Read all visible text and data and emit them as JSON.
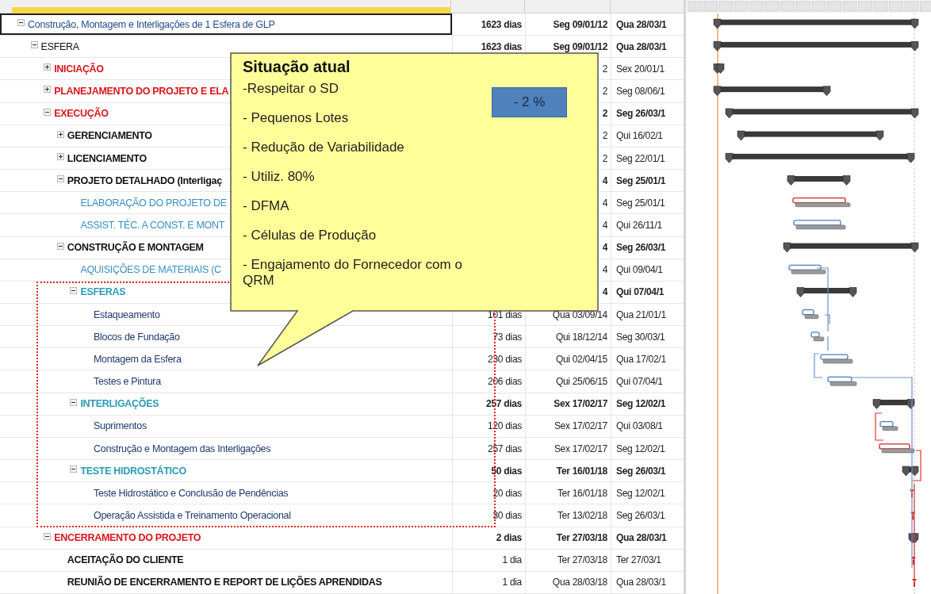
{
  "tasks": [
    {
      "name": "Construção, Montagem e Interligações de 1 Esfera de GLP",
      "color": "#1f4e8c",
      "bold": false,
      "selected": true,
      "expanded": true,
      "duration": "1623 dias",
      "start": "Seg 09/01/12",
      "finish": "Qua 28/03/1",
      "children": [
        {
          "name": "ESFERA",
          "color": "#111111",
          "bold": false,
          "selected": false,
          "expanded": true,
          "duration": "1623 dias",
          "start": "Seg 09/01/12",
          "finish": "Qua 28/03/1",
          "children": [
            {
              "name": "INICIAÇÃO",
              "color": "#d9141c",
              "bold": true,
              "selected": false,
              "expanded": false,
              "start": "2",
              "finish": "Sex 20/01/1"
            },
            {
              "name": "PLANEJAMENTO DO PROJETO E ELA",
              "color": "#d9141c",
              "bold": true,
              "selected": false,
              "expanded": false,
              "start": "2",
              "finish": "Seg 08/06/1"
            },
            {
              "name": "EXECUÇÃO",
              "color": "#d9141c",
              "bold": true,
              "selected": false,
              "expanded": true,
              "start": "2",
              "finish": "Seg 26/03/1",
              "children": [
                {
                  "name": "GERENCIAMENTO",
                  "color": "#111111",
                  "bold": true,
                  "selected": false,
                  "expanded": false,
                  "start": "2",
                  "finish": "Qui 16/02/1"
                },
                {
                  "name": "LICENCIAMENTO",
                  "color": "#111111",
                  "bold": true,
                  "selected": false,
                  "expanded": false,
                  "start": "2",
                  "finish": "Seg 22/01/1"
                },
                {
                  "name": "PROJETO DETALHADO (Interligaç",
                  "color": "#111111",
                  "bold": true,
                  "selected": false,
                  "expanded": true,
                  "start": "4",
                  "finish": "Seg 25/01/1",
                  "children": [
                    {
                      "name": "ELABORAÇÃO DO PROJETO DE",
                      "color": "#3a8fc0",
                      "bold": false,
                      "selected": false,
                      "start": "4",
                      "finish": "Seg 25/01/1"
                    },
                    {
                      "name": "ASSIST. TÉC. A CONST. E MONT",
                      "color": "#3a8fc0",
                      "bold": false,
                      "selected": false,
                      "start": "4",
                      "finish": "Qui 26/11/1"
                    }
                  ]
                },
                {
                  "name": "CONSTRUÇÃO E MONTAGEM",
                  "color": "#111111",
                  "bold": true,
                  "selected": false,
                  "expanded": true,
                  "start": "4",
                  "finish": "Seg 26/03/1",
                  "children": [
                    {
                      "name": "AQUISIÇÕES DE MATERIAIS (C",
                      "color": "#3a8fc0",
                      "bold": false,
                      "selected": false,
                      "start": "4",
                      "finish": "Qui 09/04/1"
                    },
                    {
                      "name": "ESFERAS",
                      "color": "#2b9bb5",
                      "bold": true,
                      "selected": false,
                      "expanded": true,
                      "start": "4",
                      "finish": "Qui 07/04/1",
                      "children": [
                        {
                          "name": "Estaqueamento",
                          "color": "#1f3a6e",
                          "bold": false,
                          "selected": false,
                          "duration": "101 dias",
                          "start": "Qua 03/09/14",
                          "finish": "Qua 21/01/1"
                        },
                        {
                          "name": "Blocos de Fundação",
                          "color": "#1f3a6e",
                          "bold": false,
                          "selected": false,
                          "duration": "73 dias",
                          "start": "Qui 18/12/14",
                          "finish": "Seg 30/03/1"
                        },
                        {
                          "name": "Montagem da Esfera",
                          "color": "#1f3a6e",
                          "bold": false,
                          "selected": false,
                          "duration": "230 dias",
                          "start": "Qui 02/04/15",
                          "finish": "Qua 17/02/1"
                        },
                        {
                          "name": "Testes e Pintura",
                          "color": "#1f3a6e",
                          "bold": false,
                          "selected": false,
                          "duration": "206 dias",
                          "start": "Qui 25/06/15",
                          "finish": "Qui 07/04/1"
                        }
                      ]
                    },
                    {
                      "name": "INTERLIGAÇÕES",
                      "color": "#2b9bb5",
                      "bold": true,
                      "selected": false,
                      "expanded": true,
                      "duration": "257 dias",
                      "start": "Sex 17/02/17",
                      "finish": "Seg 12/02/1",
                      "children": [
                        {
                          "name": "Suprimentos",
                          "color": "#1f3a6e",
                          "bold": false,
                          "selected": false,
                          "duration": "120 dias",
                          "start": "Sex 17/02/17",
                          "finish": "Qui 03/08/1"
                        },
                        {
                          "name": "Construção e Montagem das Interligações",
                          "color": "#1f3a6e",
                          "bold": false,
                          "selected": false,
                          "duration": "257 dias",
                          "start": "Sex 17/02/17",
                          "finish": "Seg 12/02/1"
                        }
                      ]
                    },
                    {
                      "name": "TESTE HIDROSTÁTICO",
                      "color": "#2b9bb5",
                      "bold": true,
                      "selected": false,
                      "expanded": true,
                      "duration": "50 dias",
                      "start": "Ter 16/01/18",
                      "finish": "Seg 26/03/1",
                      "children": [
                        {
                          "name": "Teste Hidrostático e Conclusão de Pendências",
                          "color": "#1f3a6e",
                          "bold": false,
                          "selected": false,
                          "duration": "20 dias",
                          "start": "Ter 16/01/18",
                          "finish": "Seg 12/02/1"
                        },
                        {
                          "name": "Operação Assistida e Treinamento Operacional",
                          "color": "#1f3a6e",
                          "bold": false,
                          "selected": false,
                          "duration": "30 dias",
                          "start": "Ter 13/02/18",
                          "finish": "Seg 26/03/1"
                        }
                      ]
                    }
                  ]
                }
              ]
            },
            {
              "name": "ENCERRAMENTO DO PROJETO",
              "color": "#d9141c",
              "bold": true,
              "selected": false,
              "expanded": true,
              "duration": "2 dias",
              "start": "Ter 27/03/18",
              "finish": "Qua 28/03/1",
              "children": [
                {
                  "name": "ACEITAÇÃO DO CLIENTE",
                  "color": "#111111",
                  "bold": true,
                  "selected": false,
                  "duration": "1 dia",
                  "start": "Ter 27/03/18",
                  "finish": "Ter 27/03/1"
                },
                {
                  "name": "REUNIÃO DE ENCERRAMENTO E REPORT DE LIÇÕES APRENDIDAS",
                  "color": "#111111",
                  "bold": true,
                  "selected": false,
                  "duration": "1 dia",
                  "start": "Qua 28/03/18",
                  "finish": "Qua 28/03/1"
                }
              ]
            }
          ]
        }
      ]
    }
  ],
  "callout": {
    "title": "Situação atual",
    "items": [
      "-Respeitar o SD",
      "- Pequenos Lotes",
      "- Redução de Variabilidade",
      "- Utiliz. 80%",
      "- DFMA",
      "- Células de Produção",
      "- Engajamento do Fornecedor com o QRM"
    ],
    "badge": "- 2 %"
  }
}
